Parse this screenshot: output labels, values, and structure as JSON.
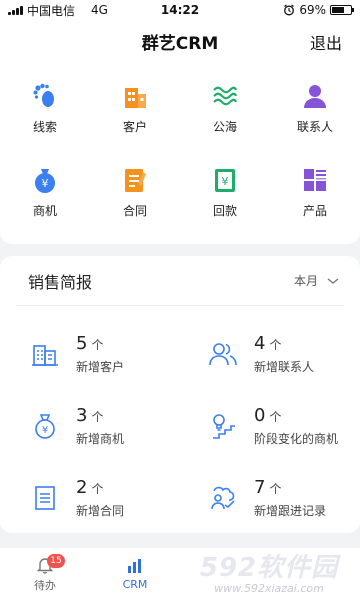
{
  "status_bar": {
    "carrier": "中国电信",
    "network": "4G",
    "time": "14:22",
    "battery": "69%",
    "battery_level": 0.69
  },
  "header": {
    "title": "群艺CRM",
    "logout": "退出"
  },
  "quick_menu": [
    {
      "label": "线索",
      "icon": "footprint-icon",
      "color": "#3b7ff0"
    },
    {
      "label": "客户",
      "icon": "building-icon",
      "color": "#f5921e"
    },
    {
      "label": "公海",
      "icon": "waves-icon",
      "color": "#1fae6a"
    },
    {
      "label": "联系人",
      "icon": "person-icon",
      "color": "#8654d8"
    },
    {
      "label": "商机",
      "icon": "money-bag-icon",
      "color": "#3b7ff0"
    },
    {
      "label": "合同",
      "icon": "contract-icon",
      "color": "#f5921e"
    },
    {
      "label": "回款",
      "icon": "payment-icon",
      "color": "#1fae6a"
    },
    {
      "label": "产品",
      "icon": "product-grid-icon",
      "color": "#8654d8"
    }
  ],
  "sales_brief": {
    "title": "销售简报",
    "period": "本月",
    "unit": "个",
    "stats": [
      {
        "value": "5",
        "label": "新增客户",
        "icon": "building-outline-icon"
      },
      {
        "value": "4",
        "label": "新增联系人",
        "icon": "contacts-icon"
      },
      {
        "value": "3",
        "label": "新增商机",
        "icon": "money-bag-outline-icon"
      },
      {
        "value": "0",
        "label": "阶段变化的商机",
        "icon": "bulb-stairs-icon"
      },
      {
        "value": "2",
        "label": "新增合同",
        "icon": "document-icon"
      },
      {
        "value": "7",
        "label": "新增跟进记录",
        "icon": "followup-icon"
      }
    ]
  },
  "tab_bar": {
    "tabs": [
      {
        "label": "待办",
        "badge": "15",
        "icon": "bell-icon"
      },
      {
        "label": "CRM",
        "icon": "bar-chart-icon",
        "active": true
      }
    ]
  },
  "watermark": {
    "main": "592软件园",
    "url": "www.592xiazai.com"
  },
  "colors": {
    "accent": "#2f6fe4",
    "badge": "#f0534e",
    "background": "#f2f3f5"
  }
}
